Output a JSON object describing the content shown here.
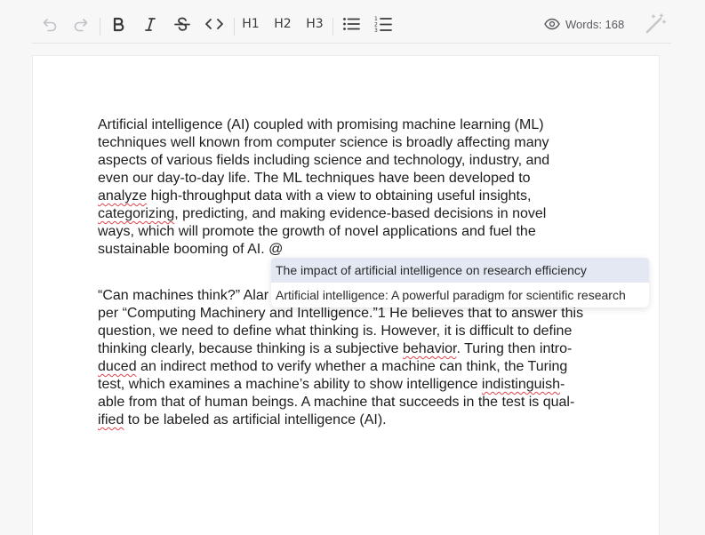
{
  "toolbar": {
    "icons": [
      "undo-icon",
      "redo-icon",
      "bold-icon",
      "italic-icon",
      "strikethrough-icon",
      "code-icon",
      "bullet-list-icon",
      "ordered-list-icon",
      "eye-icon",
      "magic-wand-icon"
    ],
    "h1": "H1",
    "h2": "H2",
    "h3": "H3",
    "word_count": "Words: 168"
  },
  "document": {
    "paragraph1": [
      "Artificial intelligence (AI) coupled with promising machine learning (ML)",
      "techniques well known from computer science is broadly affecting many",
      "aspects of various fields including science and technology, industry, and",
      "even our day-to-day life. The ML techniques have been developed to",
      "analyze",
      " high-throughput data with a view to obtaining useful insights,",
      "categorizing",
      ", predicting, and making evidence-based decisions in novel",
      "ways, which will promote the growth of novel applications and fuel the",
      "sustainable booming of AI. @"
    ],
    "paragraph2": [
      "“Can machines think?” Alar",
      "per “Computing Machinery and Intelligence.”1 He believes that to answer this",
      "question, we need to define what thinking is. However, it is difficult to define",
      "thinking clearly, because thinking is a subjective ",
      "behavior",
      ". Turing then intro-",
      "duced",
      " an indirect method to verify whether a machine can think, the Turing",
      "test, which examines a machine’s ability to show intelligence ",
      "indistinguish",
      "-",
      "able from that of human beings. A machine that succeeds in the test is qual-",
      "ified",
      " to be labeled as artificial intelligence (AI)."
    ]
  },
  "suggestions": [
    "The impact of artificial intelligence on research efficiency",
    "Artificial intelligence: A powerful paradigm for scientific research"
  ],
  "colors": {
    "spellcheck": "#e0454c",
    "active_suggestion_bg": "#e3e8f3"
  }
}
